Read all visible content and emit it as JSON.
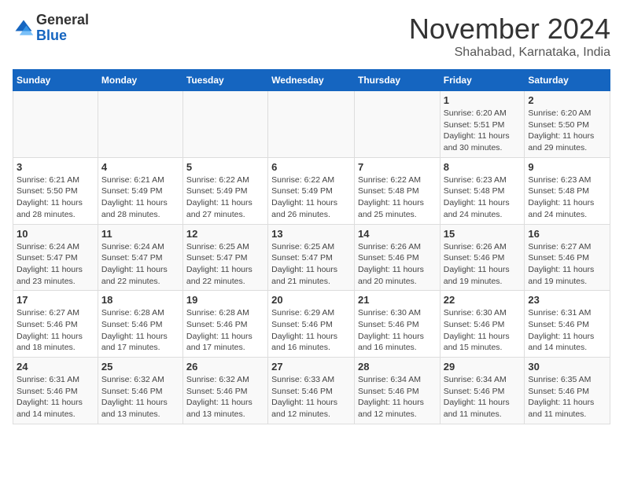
{
  "logo": {
    "general": "General",
    "blue": "Blue"
  },
  "header": {
    "month": "November 2024",
    "location": "Shahabad, Karnataka, India"
  },
  "weekdays": [
    "Sunday",
    "Monday",
    "Tuesday",
    "Wednesday",
    "Thursday",
    "Friday",
    "Saturday"
  ],
  "weeks": [
    [
      {
        "day": "",
        "info": ""
      },
      {
        "day": "",
        "info": ""
      },
      {
        "day": "",
        "info": ""
      },
      {
        "day": "",
        "info": ""
      },
      {
        "day": "",
        "info": ""
      },
      {
        "day": "1",
        "info": "Sunrise: 6:20 AM\nSunset: 5:51 PM\nDaylight: 11 hours\nand 30 minutes."
      },
      {
        "day": "2",
        "info": "Sunrise: 6:20 AM\nSunset: 5:50 PM\nDaylight: 11 hours\nand 29 minutes."
      }
    ],
    [
      {
        "day": "3",
        "info": "Sunrise: 6:21 AM\nSunset: 5:50 PM\nDaylight: 11 hours\nand 28 minutes."
      },
      {
        "day": "4",
        "info": "Sunrise: 6:21 AM\nSunset: 5:49 PM\nDaylight: 11 hours\nand 28 minutes."
      },
      {
        "day": "5",
        "info": "Sunrise: 6:22 AM\nSunset: 5:49 PM\nDaylight: 11 hours\nand 27 minutes."
      },
      {
        "day": "6",
        "info": "Sunrise: 6:22 AM\nSunset: 5:49 PM\nDaylight: 11 hours\nand 26 minutes."
      },
      {
        "day": "7",
        "info": "Sunrise: 6:22 AM\nSunset: 5:48 PM\nDaylight: 11 hours\nand 25 minutes."
      },
      {
        "day": "8",
        "info": "Sunrise: 6:23 AM\nSunset: 5:48 PM\nDaylight: 11 hours\nand 24 minutes."
      },
      {
        "day": "9",
        "info": "Sunrise: 6:23 AM\nSunset: 5:48 PM\nDaylight: 11 hours\nand 24 minutes."
      }
    ],
    [
      {
        "day": "10",
        "info": "Sunrise: 6:24 AM\nSunset: 5:47 PM\nDaylight: 11 hours\nand 23 minutes."
      },
      {
        "day": "11",
        "info": "Sunrise: 6:24 AM\nSunset: 5:47 PM\nDaylight: 11 hours\nand 22 minutes."
      },
      {
        "day": "12",
        "info": "Sunrise: 6:25 AM\nSunset: 5:47 PM\nDaylight: 11 hours\nand 22 minutes."
      },
      {
        "day": "13",
        "info": "Sunrise: 6:25 AM\nSunset: 5:47 PM\nDaylight: 11 hours\nand 21 minutes."
      },
      {
        "day": "14",
        "info": "Sunrise: 6:26 AM\nSunset: 5:46 PM\nDaylight: 11 hours\nand 20 minutes."
      },
      {
        "day": "15",
        "info": "Sunrise: 6:26 AM\nSunset: 5:46 PM\nDaylight: 11 hours\nand 19 minutes."
      },
      {
        "day": "16",
        "info": "Sunrise: 6:27 AM\nSunset: 5:46 PM\nDaylight: 11 hours\nand 19 minutes."
      }
    ],
    [
      {
        "day": "17",
        "info": "Sunrise: 6:27 AM\nSunset: 5:46 PM\nDaylight: 11 hours\nand 18 minutes."
      },
      {
        "day": "18",
        "info": "Sunrise: 6:28 AM\nSunset: 5:46 PM\nDaylight: 11 hours\nand 17 minutes."
      },
      {
        "day": "19",
        "info": "Sunrise: 6:28 AM\nSunset: 5:46 PM\nDaylight: 11 hours\nand 17 minutes."
      },
      {
        "day": "20",
        "info": "Sunrise: 6:29 AM\nSunset: 5:46 PM\nDaylight: 11 hours\nand 16 minutes."
      },
      {
        "day": "21",
        "info": "Sunrise: 6:30 AM\nSunset: 5:46 PM\nDaylight: 11 hours\nand 16 minutes."
      },
      {
        "day": "22",
        "info": "Sunrise: 6:30 AM\nSunset: 5:46 PM\nDaylight: 11 hours\nand 15 minutes."
      },
      {
        "day": "23",
        "info": "Sunrise: 6:31 AM\nSunset: 5:46 PM\nDaylight: 11 hours\nand 14 minutes."
      }
    ],
    [
      {
        "day": "24",
        "info": "Sunrise: 6:31 AM\nSunset: 5:46 PM\nDaylight: 11 hours\nand 14 minutes."
      },
      {
        "day": "25",
        "info": "Sunrise: 6:32 AM\nSunset: 5:46 PM\nDaylight: 11 hours\nand 13 minutes."
      },
      {
        "day": "26",
        "info": "Sunrise: 6:32 AM\nSunset: 5:46 PM\nDaylight: 11 hours\nand 13 minutes."
      },
      {
        "day": "27",
        "info": "Sunrise: 6:33 AM\nSunset: 5:46 PM\nDaylight: 11 hours\nand 12 minutes."
      },
      {
        "day": "28",
        "info": "Sunrise: 6:34 AM\nSunset: 5:46 PM\nDaylight: 11 hours\nand 12 minutes."
      },
      {
        "day": "29",
        "info": "Sunrise: 6:34 AM\nSunset: 5:46 PM\nDaylight: 11 hours\nand 11 minutes."
      },
      {
        "day": "30",
        "info": "Sunrise: 6:35 AM\nSunset: 5:46 PM\nDaylight: 11 hours\nand 11 minutes."
      }
    ]
  ]
}
